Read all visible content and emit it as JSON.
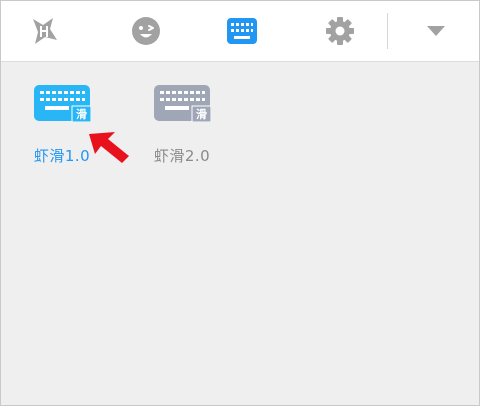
{
  "toolbar": {
    "tabs": [
      {
        "icon": "shrimp-logo-icon",
        "active": false
      },
      {
        "icon": "emoji-icon",
        "active": false
      },
      {
        "icon": "keyboard-icon",
        "active": true
      },
      {
        "icon": "gear-icon",
        "active": false
      },
      {
        "icon": "dropdown-arrow-icon",
        "active": false
      }
    ]
  },
  "keyboards": [
    {
      "label": "虾滑1.0",
      "badge": "滑",
      "selected": true
    },
    {
      "label": "虾滑2.0",
      "badge": "滑",
      "selected": false
    }
  ],
  "colors": {
    "active": "#2196f3",
    "icon_gray": "#9e9e9e",
    "keyboard_blue": "#29b6f6",
    "keyboard_gray": "#9fa6b5",
    "label_blue": "#2196f3",
    "label_gray": "#8a8a8a",
    "arrow_red": "#e8121d"
  }
}
